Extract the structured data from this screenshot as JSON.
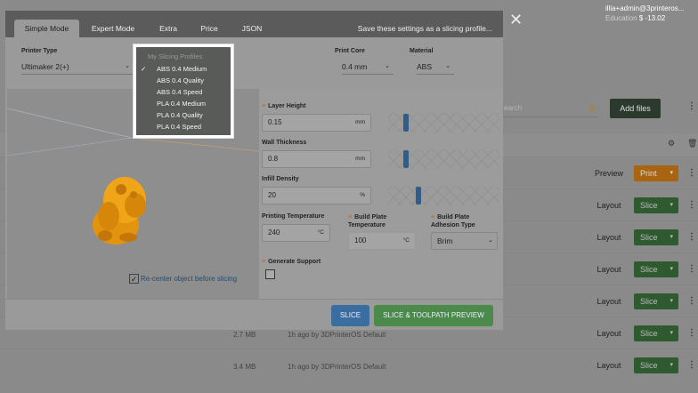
{
  "background": {
    "user": {
      "email": "illia+admin@3printeros...",
      "plan": "Education",
      "balance": "$ -13.02"
    },
    "search": {
      "placeholder": "earch"
    },
    "add_files_label": "Add files",
    "rows": [
      {
        "link": "Preview",
        "action": "Print",
        "size": "",
        "date": "",
        "printer": ""
      },
      {
        "link": "Layout",
        "action": "Slice",
        "size": "",
        "date": "",
        "printer": ""
      },
      {
        "link": "Layout",
        "action": "Slice",
        "size": "",
        "date": "",
        "printer": ""
      },
      {
        "link": "Layout",
        "action": "Slice",
        "size": "",
        "date": "",
        "printer": ""
      },
      {
        "link": "Layout",
        "action": "Slice",
        "size": "",
        "date": "",
        "printer": ""
      },
      {
        "link": "Layout",
        "action": "Slice",
        "size": "2.7 MB",
        "date": "1h ago by",
        "printer": "3DPrinterOS Default"
      },
      {
        "link": "Layout",
        "action": "Slice",
        "size": "3.4 MB",
        "date": "1h ago by",
        "printer": "3DPrinterOS Default"
      }
    ],
    "close_symbol": "✕"
  },
  "modal": {
    "tabs": [
      {
        "label": "Simple Mode",
        "active": true
      },
      {
        "label": "Expert Mode",
        "active": false
      },
      {
        "label": "Extra",
        "active": false
      },
      {
        "label": "Price",
        "active": false
      },
      {
        "label": "JSON",
        "active": false
      }
    ],
    "save_profile_label": "Save these settings as a slicing profile...",
    "printer_type": {
      "label": "Printer Type",
      "value": "Ultimaker 2(+)"
    },
    "print_core": {
      "label": "Print Core",
      "value": "0.4 mm"
    },
    "material": {
      "label": "Material",
      "value": "ABS"
    },
    "recenter_label": "Re-center object before slicing",
    "recenter_checked": true,
    "settings": {
      "layer_height": {
        "label": "Layer Height",
        "value": "0.15",
        "unit": "mm",
        "level": 0.05
      },
      "wall_thickness": {
        "label": "Wall Thickness",
        "value": "0.8",
        "unit": "mm",
        "level": 0.05
      },
      "infill_density": {
        "label": "Infill Density",
        "value": "20",
        "unit": "%",
        "level": 0.2
      },
      "printing_temperature": {
        "label": "Printing Temperature",
        "value": "240",
        "unit": "°C"
      },
      "build_plate_temperature": {
        "label": "Build Plate Temperature",
        "value": "100",
        "unit": "°C"
      },
      "build_plate_adhesion": {
        "label": "Build Plate Adhesion Type",
        "value": "Brim"
      },
      "generate_support": {
        "label": "Generate Support",
        "checked": false
      }
    },
    "buttons": {
      "slice": "SLICE",
      "slice_preview": "SLICE & TOOLPATH PREVIEW"
    },
    "profiles_dropdown": {
      "header": "My Slicing Profiles",
      "selected_index": 0,
      "items": [
        "ABS 0.4 Medium",
        "ABS 0.4 Quality",
        "ABS 0.4 Speed",
        "PLA 0.4 Medium",
        "PLA 0.4 Quality",
        "PLA 0.4 Speed"
      ]
    }
  },
  "colors": {
    "accent_orange": "#e8a33d",
    "slice_blue": "#3a6da0",
    "preview_green": "#4c8a4c"
  }
}
